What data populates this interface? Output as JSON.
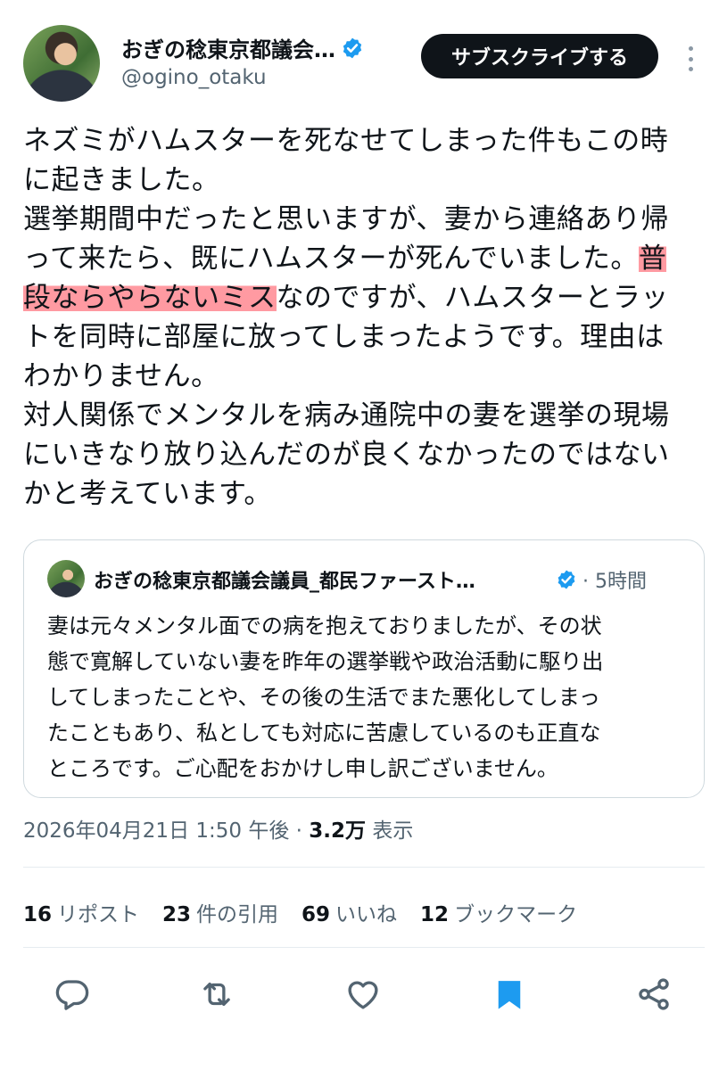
{
  "header": {
    "display_name": "おぎの稔東京都議会…",
    "handle": "@ogino_otaku",
    "subscribe_label": "サブスクライブする"
  },
  "tweet": {
    "lines": [
      "ネズミがハムスターを死なせてしまった件もこの時",
      "に起きました。",
      "選挙期間中だったと思いますが、妻から連絡あり帰",
      "って来たら、既にハムスターが死んでいました。",
      "普",
      "段ならやらないミス",
      "なのですが、ハムスターとラッ",
      "トを同時に部屋に放ってしまったようです。理由は",
      "わかりません。",
      "対人関係でメンタルを病み通院中の妻を選挙の現場",
      "にいきなり放り込んだのが良くなかったのではない",
      "かと考えています。"
    ]
  },
  "quote": {
    "name": "おぎの稔東京都議会議員_都民ファースト…",
    "time": "· 5時間",
    "lines": [
      "妻は元々メンタル面での病を抱えておりましたが、その状",
      "態で寛解していない妻を昨年の選挙戦や政治活動に駆り出",
      "してしまったことや、その後の生活でまた悪化してしまっ",
      "たこともあり、私としても対応に苦慮しているのも正直な",
      "ところです。ご心配をおかけし申し訳ございません。"
    ]
  },
  "meta": {
    "datetime": "2026年04月21日 1:50 午後 · ",
    "views_count": "3.2万",
    "views_label": " 表示"
  },
  "stats": [
    {
      "num": "16",
      "label": "リポスト"
    },
    {
      "num": "23",
      "label": "件の引用"
    },
    {
      "num": "69",
      "label": "いいね"
    },
    {
      "num": "12",
      "label": "ブックマーク"
    }
  ],
  "colors": {
    "accent": "#1d9bf0",
    "highlight": "#ff7882",
    "muted": "#536471"
  },
  "icons": [
    "reply-icon",
    "repost-icon",
    "like-icon",
    "bookmark-icon",
    "share-icon",
    "verified-badge-icon",
    "more-icon"
  ]
}
